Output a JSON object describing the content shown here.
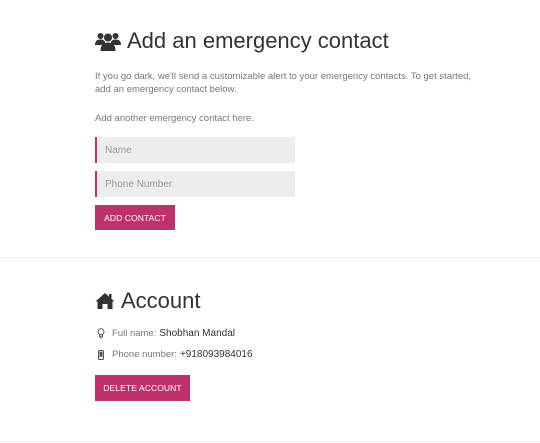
{
  "emergency": {
    "title": "Add an emergency contact",
    "title_icon": "users-icon",
    "description": "If you go dark, we'll send a customizable alert to your emergency contacts. To get started, add an emergency contact below.",
    "add_another": "Add another emergency contact here.",
    "name_placeholder": "Name",
    "phone_placeholder": "Phone Number",
    "add_button": "ADD CONTACT"
  },
  "account": {
    "title": "Account",
    "title_icon": "home-icon",
    "full_name_label": "Full name:",
    "full_name_value": "Shobhan Mandal",
    "phone_label": "Phone number:",
    "phone_value": "+918093984016",
    "delete_button": "DELETE ACCOUNT"
  },
  "colors": {
    "accent": "#c0306a",
    "field_bg": "#ededed",
    "heading": "#333333"
  }
}
